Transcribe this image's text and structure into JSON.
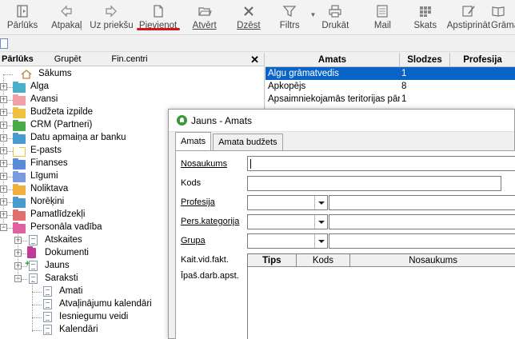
{
  "toolbar": {
    "buttons": [
      {
        "label": "Pārlūks",
        "icon": "browser-icon"
      },
      {
        "label": "Atpakaļ",
        "icon": "back-arrow-icon"
      },
      {
        "label": "Uz priekšu",
        "icon": "forward-arrow-icon"
      },
      {
        "label": "Pievienot",
        "icon": "new-document-icon"
      },
      {
        "label": "Atvērt",
        "icon": "open-folder-icon"
      },
      {
        "label": "Dzēst",
        "icon": "delete-x-icon"
      },
      {
        "label": "Filtrs",
        "icon": "filter-funnel-icon"
      },
      {
        "label": "Drukāt",
        "icon": "printer-icon"
      },
      {
        "label": "Mail",
        "icon": "mail-icon"
      },
      {
        "label": "Skats",
        "icon": "view-grid-icon"
      },
      {
        "label": "Apstiprināt",
        "icon": "approve-pen-icon"
      },
      {
        "label": "Grāma",
        "icon": "book-icon"
      }
    ],
    "active_underline_color": "#d4161c"
  },
  "left_panel": {
    "tabs": [
      "Pārlūks",
      "Grupēt",
      "Fin.centri"
    ],
    "close_symbol": "✕",
    "tree": [
      {
        "label": "Sākums",
        "type": "home",
        "level": 0
      },
      {
        "label": "Alga",
        "type": "folder",
        "color": "#4ab0c8",
        "level": 0,
        "expander": "+"
      },
      {
        "label": "Avansi",
        "type": "folder",
        "color": "#f0a0a8",
        "level": 0,
        "expander": "+"
      },
      {
        "label": "Budžeta izpilde",
        "type": "folder",
        "color": "#f0c040",
        "level": 0,
        "expander": "+"
      },
      {
        "label": "CRM (Partneri)",
        "type": "folder",
        "color": "#4aaa4a",
        "level": 0,
        "expander": "+"
      },
      {
        "label": "Datu apmaiņa ar banku",
        "type": "folder",
        "color": "#4a9ad0",
        "level": 0,
        "expander": "+"
      },
      {
        "label": "E-pasts",
        "type": "mail",
        "color": "#f0c040",
        "level": 0,
        "expander": "+"
      },
      {
        "label": "Finanses",
        "type": "folder",
        "color": "#5a8ad8",
        "level": 0,
        "expander": "+"
      },
      {
        "label": "Līgumi",
        "type": "folder",
        "color": "#7a9ae0",
        "level": 0,
        "expander": "+"
      },
      {
        "label": "Noliktava",
        "type": "folder",
        "color": "#f0b040",
        "level": 0,
        "expander": "+"
      },
      {
        "label": "Norēķini",
        "type": "folder",
        "color": "#4a9ad0",
        "level": 0,
        "expander": "+"
      },
      {
        "label": "Pamatlīdzekļi",
        "type": "folder",
        "color": "#e07070",
        "level": 0,
        "expander": "+"
      },
      {
        "label": "Personāla vadība",
        "type": "folder",
        "color": "#e060a0",
        "level": 0,
        "expander": "−"
      },
      {
        "label": "Atskaites",
        "type": "page",
        "level": 1,
        "expander": "+"
      },
      {
        "label": "Dokumenti",
        "type": "book",
        "color": "#c03a9a",
        "level": 1,
        "expander": "+"
      },
      {
        "label": "Jauns",
        "type": "page-new",
        "level": 1,
        "expander": "+"
      },
      {
        "label": "Saraksti",
        "type": "page",
        "level": 1,
        "expander": "−"
      },
      {
        "label": "Amati",
        "type": "page",
        "level": 2
      },
      {
        "label": "Atvaļinājumu kalendāri",
        "type": "page",
        "level": 2
      },
      {
        "label": "Iesniegumu veidi",
        "type": "page",
        "level": 2
      },
      {
        "label": "Kalendāri",
        "type": "page",
        "level": 2
      }
    ]
  },
  "right_panel": {
    "columns": [
      "Amats",
      "Slodzes",
      "Profesija"
    ],
    "rows": [
      {
        "amats": "Algu grāmatvedis",
        "slodzes": "1",
        "profesija": "",
        "selected": true
      },
      {
        "amats": "Apkopējs",
        "slodzes": "8",
        "profesija": "",
        "selected": false
      },
      {
        "amats": "Apsaimniekojamās teritorijas pārzinis",
        "slodzes": "1",
        "profesija": "",
        "selected": false
      }
    ],
    "selected_color": "#0a64c8"
  },
  "dialog": {
    "title": "Jauns - Amats",
    "tabs": [
      "Amats",
      "Amata budžets"
    ],
    "fields": {
      "nosaukums": {
        "label": "Nosaukums",
        "value": ""
      },
      "kods": {
        "label": "Kods",
        "value": ""
      },
      "profesija": {
        "label": "Profesija",
        "value": ""
      },
      "pers_kategorija": {
        "label": "Pers.kategorija",
        "value": ""
      },
      "grupa": {
        "label": "Grupa",
        "value": ""
      }
    },
    "kait_label": "Kait.vid.fakt.",
    "ipas_label": "Īpaš.darb.apst.",
    "grid_columns": [
      "Tips",
      "Kods",
      "Nosaukums"
    ]
  }
}
